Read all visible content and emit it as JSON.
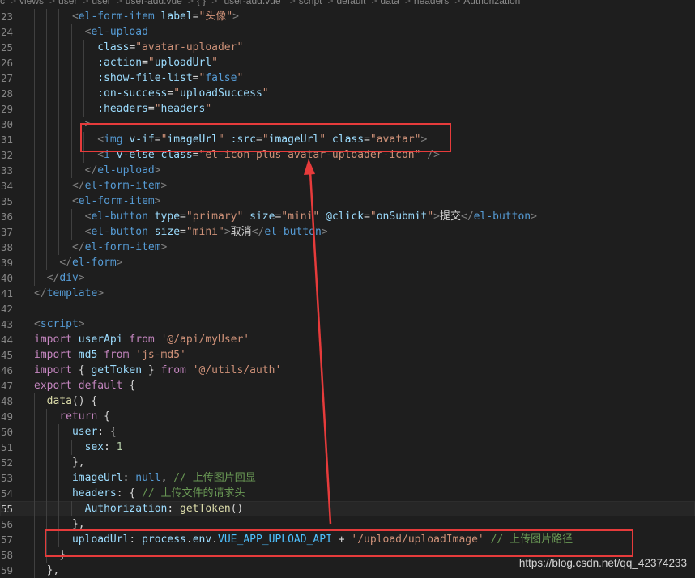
{
  "breadcrumb": {
    "items": [
      "c",
      "views",
      "user",
      "user",
      "user-add.vue",
      "{ }",
      "\"user-add.vue\"",
      "script",
      "default",
      "data",
      "headers",
      "Authorization"
    ],
    "icons": [
      "folder-icon",
      "vue-file-icon",
      "braces-icon",
      "symbol-icon",
      "wrench-icon"
    ]
  },
  "active_line": 55,
  "lines": [
    {
      "n": "23",
      "tokens": [
        [
          "      ",
          "t-text"
        ],
        [
          "<",
          "t-punc"
        ],
        [
          "el-form-item",
          "t-tag"
        ],
        [
          " label",
          "t-attr"
        ],
        [
          "=",
          "t-text"
        ],
        [
          "\"头像\"",
          "t-str"
        ],
        [
          ">",
          "t-punc"
        ]
      ]
    },
    {
      "n": "24",
      "tokens": [
        [
          "        ",
          "t-text"
        ],
        [
          "<",
          "t-punc"
        ],
        [
          "el-upload",
          "t-tag"
        ]
      ]
    },
    {
      "n": "25",
      "tokens": [
        [
          "          class",
          "t-attr"
        ],
        [
          "=",
          "t-text"
        ],
        [
          "\"avatar-uploader\"",
          "t-str"
        ]
      ]
    },
    {
      "n": "26",
      "tokens": [
        [
          "          :action",
          "t-attr"
        ],
        [
          "=",
          "t-text"
        ],
        [
          "\"",
          "t-str"
        ],
        [
          "uploadUrl",
          "t-var"
        ],
        [
          "\"",
          "t-str"
        ]
      ]
    },
    {
      "n": "27",
      "tokens": [
        [
          "          :show-file-list",
          "t-attr"
        ],
        [
          "=",
          "t-text"
        ],
        [
          "\"",
          "t-str"
        ],
        [
          "false",
          "t-kw2"
        ],
        [
          "\"",
          "t-str"
        ]
      ]
    },
    {
      "n": "28",
      "tokens": [
        [
          "          :on-success",
          "t-attr"
        ],
        [
          "=",
          "t-text"
        ],
        [
          "\"",
          "t-str"
        ],
        [
          "uploadSuccess",
          "t-var"
        ],
        [
          "\"",
          "t-str"
        ]
      ]
    },
    {
      "n": "29",
      "tokens": [
        [
          "          :headers",
          "t-attr"
        ],
        [
          "=",
          "t-text"
        ],
        [
          "\"",
          "t-str"
        ],
        [
          "headers",
          "t-var"
        ],
        [
          "\"",
          "t-str"
        ]
      ]
    },
    {
      "n": "30",
      "tokens": [
        [
          "        >",
          "t-punc"
        ]
      ]
    },
    {
      "n": "31",
      "tokens": [
        [
          "          ",
          "t-text"
        ],
        [
          "<",
          "t-punc"
        ],
        [
          "img",
          "t-tag"
        ],
        [
          " v-if",
          "t-attr"
        ],
        [
          "=",
          "t-text"
        ],
        [
          "\"",
          "t-str"
        ],
        [
          "imageUrl",
          "t-var"
        ],
        [
          "\"",
          "t-str"
        ],
        [
          " :src",
          "t-attr"
        ],
        [
          "=",
          "t-text"
        ],
        [
          "\"",
          "t-str"
        ],
        [
          "imageUrl",
          "t-var"
        ],
        [
          "\"",
          "t-str"
        ],
        [
          " class",
          "t-attr"
        ],
        [
          "=",
          "t-text"
        ],
        [
          "\"avatar\"",
          "t-str"
        ],
        [
          ">",
          "t-punc"
        ]
      ]
    },
    {
      "n": "32",
      "tokens": [
        [
          "          ",
          "t-text"
        ],
        [
          "<",
          "t-punc"
        ],
        [
          "i",
          "t-tag"
        ],
        [
          " v-else",
          "t-attr"
        ],
        [
          " class",
          "t-attr"
        ],
        [
          "=",
          "t-text"
        ],
        [
          "\"el-icon-plus avatar-uploader-icon\"",
          "t-str"
        ],
        [
          " />",
          "t-punc"
        ]
      ]
    },
    {
      "n": "33",
      "tokens": [
        [
          "        ",
          "t-text"
        ],
        [
          "</",
          "t-punc"
        ],
        [
          "el-upload",
          "t-tag"
        ],
        [
          ">",
          "t-punc"
        ]
      ]
    },
    {
      "n": "34",
      "tokens": [
        [
          "      ",
          "t-text"
        ],
        [
          "</",
          "t-punc"
        ],
        [
          "el-form-item",
          "t-tag"
        ],
        [
          ">",
          "t-punc"
        ]
      ]
    },
    {
      "n": "35",
      "tokens": [
        [
          "      ",
          "t-text"
        ],
        [
          "<",
          "t-punc"
        ],
        [
          "el-form-item",
          "t-tag"
        ],
        [
          ">",
          "t-punc"
        ]
      ]
    },
    {
      "n": "36",
      "tokens": [
        [
          "        ",
          "t-text"
        ],
        [
          "<",
          "t-punc"
        ],
        [
          "el-button",
          "t-tag"
        ],
        [
          " type",
          "t-attr"
        ],
        [
          "=",
          "t-text"
        ],
        [
          "\"primary\"",
          "t-str"
        ],
        [
          " size",
          "t-attr"
        ],
        [
          "=",
          "t-text"
        ],
        [
          "\"mini\"",
          "t-str"
        ],
        [
          " @click",
          "t-attr"
        ],
        [
          "=",
          "t-text"
        ],
        [
          "\"",
          "t-str"
        ],
        [
          "onSubmit",
          "t-var"
        ],
        [
          "\"",
          "t-str"
        ],
        [
          ">",
          "t-punc"
        ],
        [
          "提交",
          "t-text"
        ],
        [
          "</",
          "t-punc"
        ],
        [
          "el-button",
          "t-tag"
        ],
        [
          ">",
          "t-punc"
        ]
      ]
    },
    {
      "n": "37",
      "tokens": [
        [
          "        ",
          "t-text"
        ],
        [
          "<",
          "t-punc"
        ],
        [
          "el-button",
          "t-tag"
        ],
        [
          " size",
          "t-attr"
        ],
        [
          "=",
          "t-text"
        ],
        [
          "\"mini\"",
          "t-str"
        ],
        [
          ">",
          "t-punc"
        ],
        [
          "取消",
          "t-text"
        ],
        [
          "</",
          "t-punc"
        ],
        [
          "el-button",
          "t-tag"
        ],
        [
          ">",
          "t-punc"
        ]
      ]
    },
    {
      "n": "38",
      "tokens": [
        [
          "      ",
          "t-text"
        ],
        [
          "</",
          "t-punc"
        ],
        [
          "el-form-item",
          "t-tag"
        ],
        [
          ">",
          "t-punc"
        ]
      ]
    },
    {
      "n": "39",
      "tokens": [
        [
          "    ",
          "t-text"
        ],
        [
          "</",
          "t-punc"
        ],
        [
          "el-form",
          "t-tag"
        ],
        [
          ">",
          "t-punc"
        ]
      ]
    },
    {
      "n": "40",
      "tokens": [
        [
          "  ",
          "t-text"
        ],
        [
          "</",
          "t-punc"
        ],
        [
          "div",
          "t-tag"
        ],
        [
          ">",
          "t-punc"
        ]
      ]
    },
    {
      "n": "41",
      "tokens": [
        [
          "</",
          "t-punc"
        ],
        [
          "template",
          "t-tag"
        ],
        [
          ">",
          "t-punc"
        ]
      ]
    },
    {
      "n": "42",
      "tokens": []
    },
    {
      "n": "43",
      "tokens": [
        [
          "<",
          "t-punc"
        ],
        [
          "script",
          "t-tag"
        ],
        [
          ">",
          "t-punc"
        ]
      ]
    },
    {
      "n": "44",
      "tokens": [
        [
          "import",
          "t-kw"
        ],
        [
          " userApi ",
          "t-var"
        ],
        [
          "from",
          "t-kw"
        ],
        [
          " ",
          "t-text"
        ],
        [
          "'@/api/myUser'",
          "t-str"
        ]
      ]
    },
    {
      "n": "45",
      "tokens": [
        [
          "import",
          "t-kw"
        ],
        [
          " md5 ",
          "t-var"
        ],
        [
          "from",
          "t-kw"
        ],
        [
          " ",
          "t-text"
        ],
        [
          "'js-md5'",
          "t-str"
        ]
      ]
    },
    {
      "n": "46",
      "tokens": [
        [
          "import",
          "t-kw"
        ],
        [
          " { ",
          "t-text"
        ],
        [
          "getToken",
          "t-var"
        ],
        [
          " } ",
          "t-text"
        ],
        [
          "from",
          "t-kw"
        ],
        [
          " ",
          "t-text"
        ],
        [
          "'@/utils/auth'",
          "t-str"
        ]
      ]
    },
    {
      "n": "47",
      "tokens": [
        [
          "export",
          "t-kw"
        ],
        [
          " ",
          "t-text"
        ],
        [
          "default",
          "t-kw"
        ],
        [
          " {",
          "t-text"
        ]
      ]
    },
    {
      "n": "48",
      "tokens": [
        [
          "  ",
          "t-text"
        ],
        [
          "data",
          "t-fn"
        ],
        [
          "() {",
          "t-text"
        ]
      ]
    },
    {
      "n": "49",
      "tokens": [
        [
          "    ",
          "t-text"
        ],
        [
          "return",
          "t-kw"
        ],
        [
          " {",
          "t-text"
        ]
      ]
    },
    {
      "n": "50",
      "tokens": [
        [
          "      ",
          "t-text"
        ],
        [
          "user",
          "t-var"
        ],
        [
          ": {",
          "t-text"
        ]
      ]
    },
    {
      "n": "51",
      "tokens": [
        [
          "        ",
          "t-text"
        ],
        [
          "sex",
          "t-var"
        ],
        [
          ": ",
          "t-text"
        ],
        [
          "1",
          "t-num"
        ]
      ]
    },
    {
      "n": "52",
      "tokens": [
        [
          "      },",
          "t-text"
        ]
      ]
    },
    {
      "n": "53",
      "tokens": [
        [
          "      ",
          "t-text"
        ],
        [
          "imageUrl",
          "t-var"
        ],
        [
          ": ",
          "t-text"
        ],
        [
          "null",
          "t-kw2"
        ],
        [
          ", ",
          "t-text"
        ],
        [
          "// 上传图片回显",
          "t-com"
        ]
      ]
    },
    {
      "n": "54",
      "tokens": [
        [
          "      ",
          "t-text"
        ],
        [
          "headers",
          "t-var"
        ],
        [
          ": { ",
          "t-text"
        ],
        [
          "// 上传文件的请求头",
          "t-com"
        ]
      ]
    },
    {
      "n": "55",
      "tokens": [
        [
          "        ",
          "t-text"
        ],
        [
          "Authorization",
          "t-var"
        ],
        [
          ": ",
          "t-text"
        ],
        [
          "getToken",
          "t-fn"
        ],
        [
          "()",
          "t-text"
        ]
      ]
    },
    {
      "n": "56",
      "tokens": [
        [
          "      },",
          "t-text"
        ]
      ]
    },
    {
      "n": "57",
      "tokens": [
        [
          "      ",
          "t-text"
        ],
        [
          "uploadUrl",
          "t-var"
        ],
        [
          ": ",
          "t-text"
        ],
        [
          "process",
          "t-var"
        ],
        [
          ".",
          "t-text"
        ],
        [
          "env",
          "t-var"
        ],
        [
          ".",
          "t-text"
        ],
        [
          "VUE_APP_UPLOAD_API",
          "t-const"
        ],
        [
          " + ",
          "t-text"
        ],
        [
          "'/upload/uploadImage'",
          "t-str"
        ],
        [
          " ",
          "t-text"
        ],
        [
          "// 上传图片路径",
          "t-com"
        ]
      ]
    },
    {
      "n": "58",
      "tokens": [
        [
          "    }",
          "t-text"
        ]
      ]
    },
    {
      "n": "59",
      "tokens": [
        [
          "  },",
          "t-text"
        ]
      ]
    }
  ],
  "watermark": "https://blog.csdn.net/qq_42374233"
}
